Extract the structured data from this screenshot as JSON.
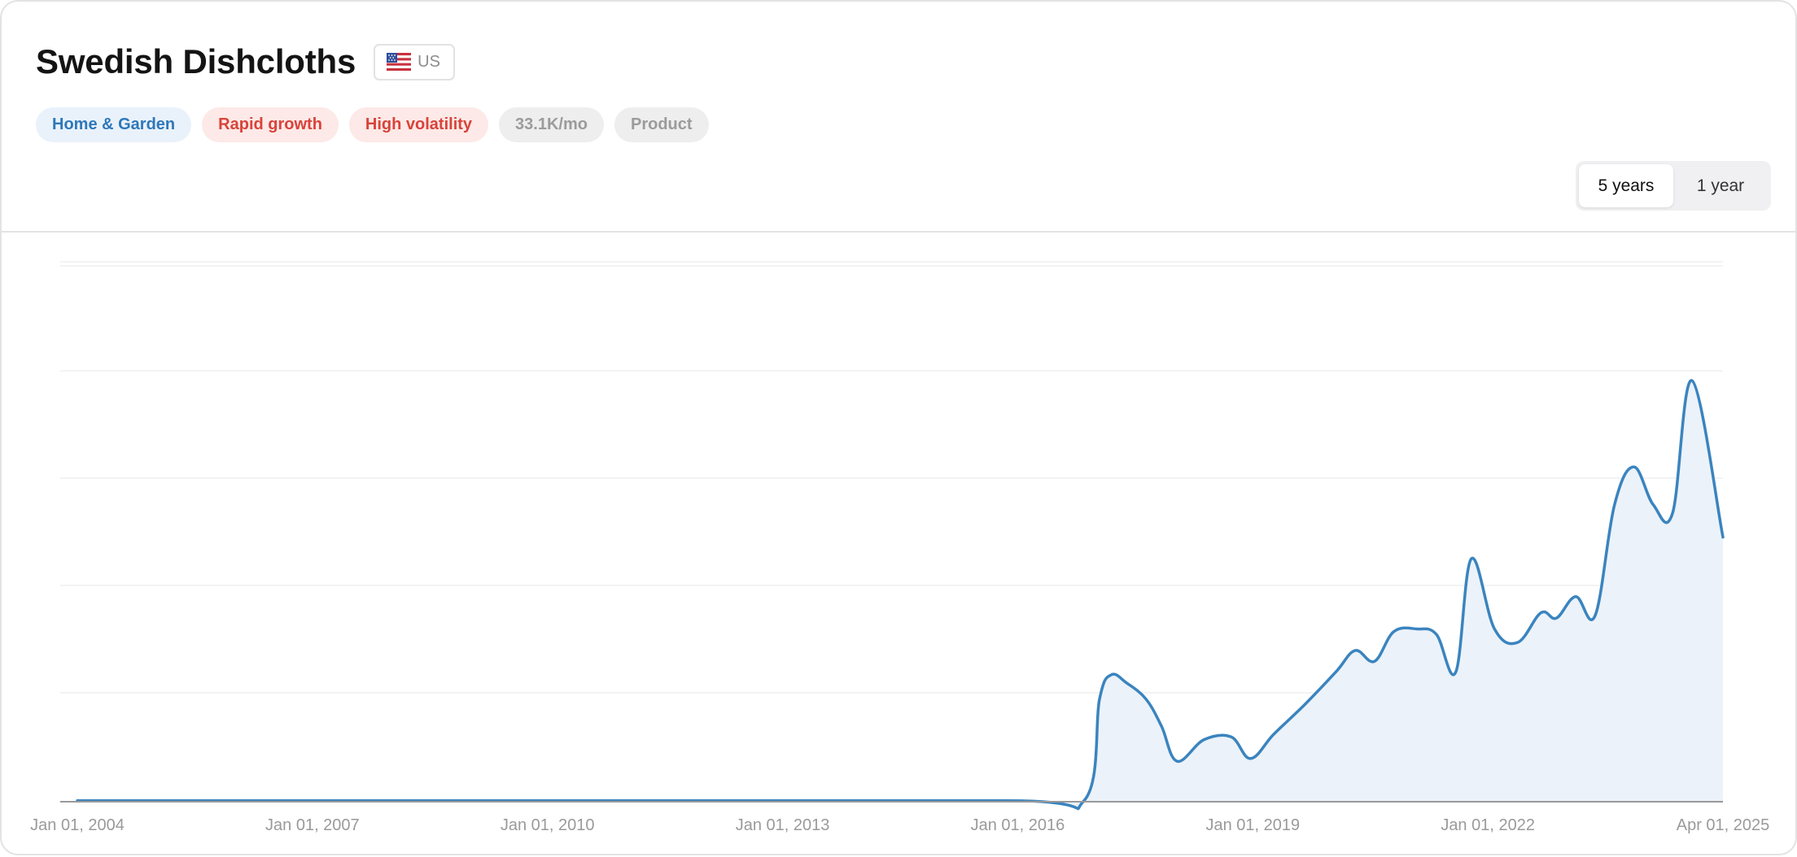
{
  "header": {
    "title": "Swedish Dishcloths",
    "region": {
      "flag_icon": "us-flag-icon",
      "code": "US"
    },
    "tags": [
      {
        "label": "Home & Garden",
        "color": "#2f78b8"
      },
      {
        "label": "Rapid growth",
        "color": "#d8433a"
      },
      {
        "label": "High volatility",
        "color": "#d8433a"
      },
      {
        "label": "33.1K/mo",
        "color": "#9b9b9b"
      },
      {
        "label": "Product",
        "color": "#9b9b9b"
      }
    ],
    "range_options": [
      "5 years",
      "1 year"
    ],
    "selected_range": "5 years"
  },
  "chart_data": {
    "type": "area",
    "title": "",
    "xlabel": "",
    "ylabel": "",
    "line_color": "#3a84bf",
    "fill_color": "#ecf2f9",
    "grid": true,
    "x_ticks": [
      "Jan 01, 2004",
      "Jan 01, 2007",
      "Jan 01, 2010",
      "Jan 01, 2013",
      "Jan 01, 2016",
      "Jan 01, 2019",
      "Jan 01, 2022",
      "Apr 01, 2025"
    ],
    "x_range": [
      2004.0,
      2025.25
    ],
    "ylim": [
      0,
      100
    ],
    "series": [
      {
        "points": [
          [
            2004.0,
            0.2
          ],
          [
            2010.0,
            0.2
          ],
          [
            2016.0,
            0.2
          ],
          [
            2017.0,
            0.2
          ],
          [
            2017.2,
            19
          ],
          [
            2017.35,
            23.5
          ],
          [
            2017.55,
            22
          ],
          [
            2017.8,
            19
          ],
          [
            2018.0,
            14
          ],
          [
            2018.2,
            7.5
          ],
          [
            2018.55,
            11.5
          ],
          [
            2018.9,
            12
          ],
          [
            2019.15,
            8
          ],
          [
            2019.45,
            12.5
          ],
          [
            2019.85,
            18
          ],
          [
            2020.25,
            24
          ],
          [
            2020.5,
            28
          ],
          [
            2020.75,
            26
          ],
          [
            2021.0,
            31.5
          ],
          [
            2021.3,
            32
          ],
          [
            2021.55,
            31
          ],
          [
            2021.8,
            24
          ],
          [
            2022.0,
            45
          ],
          [
            2022.3,
            32
          ],
          [
            2022.6,
            29.5
          ],
          [
            2022.9,
            35
          ],
          [
            2023.1,
            34
          ],
          [
            2023.35,
            38
          ],
          [
            2023.6,
            34.5
          ],
          [
            2023.85,
            55
          ],
          [
            2024.1,
            62
          ],
          [
            2024.35,
            55
          ],
          [
            2024.6,
            53.5
          ],
          [
            2024.85,
            78
          ],
          [
            2025.25,
            49
          ]
        ]
      }
    ]
  }
}
